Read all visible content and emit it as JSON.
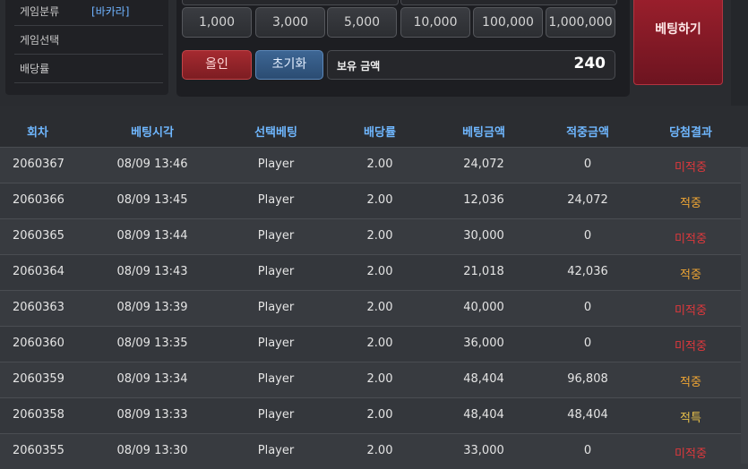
{
  "info": {
    "rows": [
      {
        "label": "게임분류",
        "value": "[바카라]"
      },
      {
        "label": "게임선택",
        "value": ""
      },
      {
        "label": "배당률",
        "value": ""
      }
    ]
  },
  "chips": [
    "1,000",
    "3,000",
    "5,000",
    "10,000",
    "100,000",
    "1,000,000"
  ],
  "actions": {
    "allin_label": "올인",
    "reset_label": "초기화",
    "balance_label": "보유 금액",
    "balance_value": "240",
    "bet_label": "베팅하기"
  },
  "table": {
    "headers": [
      "회차",
      "베팅시각",
      "선택베팅",
      "배당률",
      "베팅금액",
      "적중금액",
      "당첨결과"
    ],
    "rows": [
      {
        "round": "2060367",
        "time": "08/09 13:46",
        "pick": "Player",
        "odds": "2.00",
        "bet": "24,072",
        "win": "0",
        "result": "미적중"
      },
      {
        "round": "2060366",
        "time": "08/09 13:45",
        "pick": "Player",
        "odds": "2.00",
        "bet": "12,036",
        "win": "24,072",
        "result": "적중"
      },
      {
        "round": "2060365",
        "time": "08/09 13:44",
        "pick": "Player",
        "odds": "2.00",
        "bet": "30,000",
        "win": "0",
        "result": "미적중"
      },
      {
        "round": "2060364",
        "time": "08/09 13:43",
        "pick": "Player",
        "odds": "2.00",
        "bet": "21,018",
        "win": "42,036",
        "result": "적중"
      },
      {
        "round": "2060363",
        "time": "08/09 13:39",
        "pick": "Player",
        "odds": "2.00",
        "bet": "40,000",
        "win": "0",
        "result": "미적중"
      },
      {
        "round": "2060360",
        "time": "08/09 13:35",
        "pick": "Player",
        "odds": "2.00",
        "bet": "36,000",
        "win": "0",
        "result": "미적중"
      },
      {
        "round": "2060359",
        "time": "08/09 13:34",
        "pick": "Player",
        "odds": "2.00",
        "bet": "48,404",
        "win": "96,808",
        "result": "적중"
      },
      {
        "round": "2060358",
        "time": "08/09 13:33",
        "pick": "Player",
        "odds": "2.00",
        "bet": "48,404",
        "win": "48,404",
        "result": "적특"
      },
      {
        "round": "2060355",
        "time": "08/09 13:30",
        "pick": "Player",
        "odds": "2.00",
        "bet": "33,000",
        "win": "0",
        "result": "미적중"
      }
    ]
  },
  "colors": {
    "header_text": "#6fb7ff",
    "result_miss": "#e0383c",
    "result_hit": "#f0a634",
    "result_special": "#e8c04a",
    "bet_button": "#8a1b27"
  }
}
